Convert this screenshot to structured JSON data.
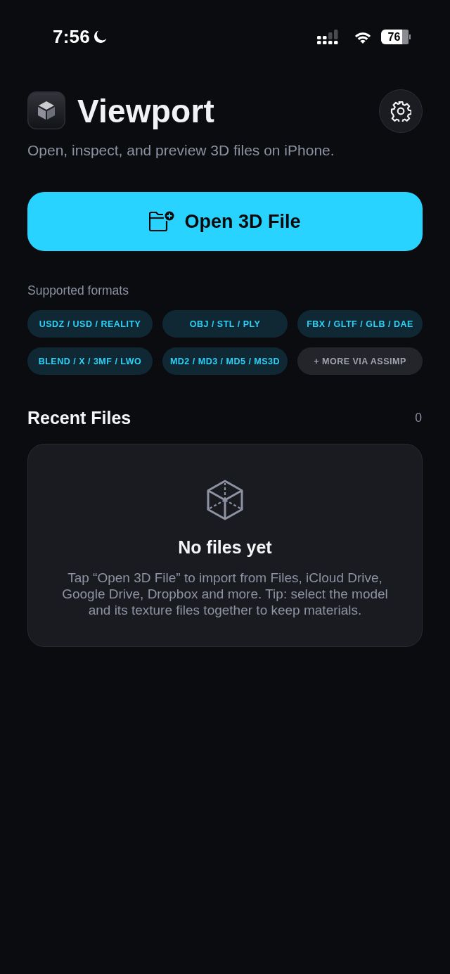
{
  "status_bar": {
    "time": "7:56",
    "battery": "76"
  },
  "header": {
    "title": "Viewport",
    "subtitle": "Open, inspect, and preview 3D files on iPhone."
  },
  "open_button": {
    "label": "Open 3D File"
  },
  "formats": {
    "heading": "Supported formats",
    "chips": [
      {
        "label": "USDZ / USD / REALITY",
        "kind": "format"
      },
      {
        "label": "OBJ / STL / PLY",
        "kind": "format"
      },
      {
        "label": "FBX / GLTF / GLB / DAE",
        "kind": "format"
      },
      {
        "label": "BLEND / X / 3MF / LWO",
        "kind": "format"
      },
      {
        "label": "MD2 / MD3 / MD5 / MS3D",
        "kind": "format"
      },
      {
        "label": "+ MORE VIA ASSIMP",
        "kind": "more"
      }
    ]
  },
  "recent_files": {
    "heading": "Recent Files",
    "count": "0",
    "empty_state": {
      "title": "No files yet",
      "message": "Tap “Open 3D File” to import from Files, iCloud Drive, Google Drive, Dropbox and more. Tip: select the model and its texture files together to keep materials."
    }
  }
}
